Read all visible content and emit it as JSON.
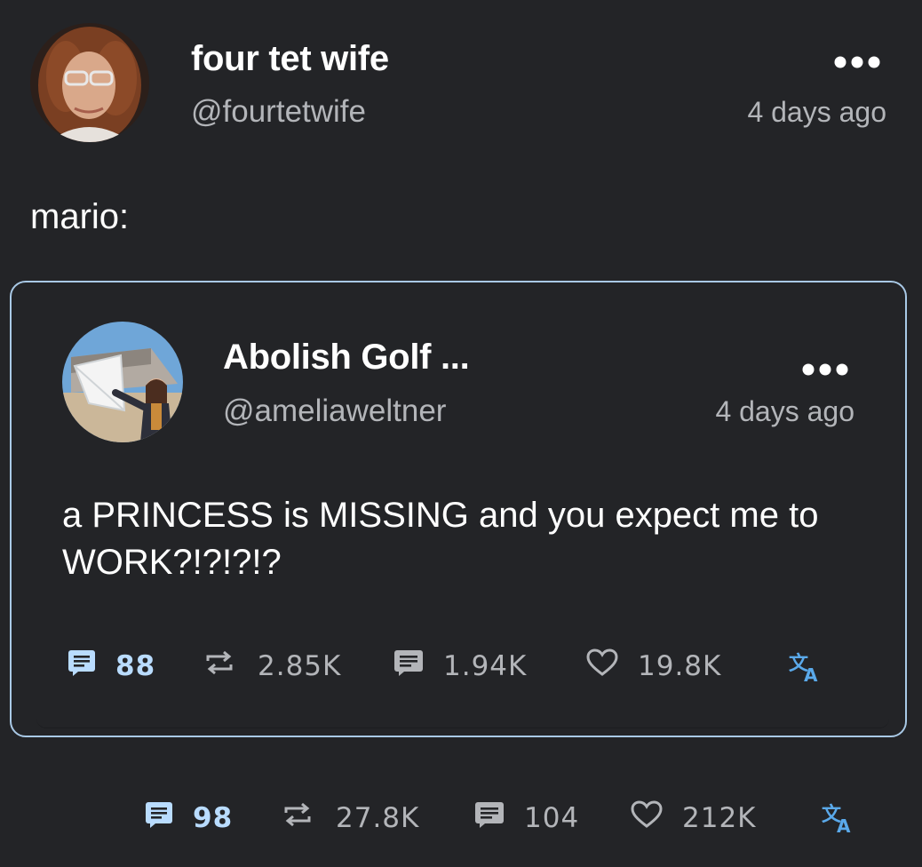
{
  "post": {
    "author": {
      "display_name": "four tet wife",
      "handle": "@fourtetwife"
    },
    "time": "4 days ago",
    "more_icon": "more-horizontal-icon",
    "text": "mario:",
    "quote": {
      "author": {
        "display_name": "Abolish Golf ...",
        "handle": "@ameliaweltner"
      },
      "time": "4 days ago",
      "text": "a PRINCESS is MISSING and you expect me to WORK?!?!?!?",
      "stats": {
        "quotes": "88",
        "reposts": "2.85K",
        "replies": "1.94K",
        "likes": "19.8K"
      }
    },
    "stats": {
      "quotes": "98",
      "reposts": "27.8K",
      "replies": "104",
      "likes": "212K"
    }
  },
  "colors": {
    "background": "#232427",
    "quote_border": "#a9c9e6",
    "quote_count": "#b9dcff",
    "muted_text": "#b3b5b9",
    "translate_accent": "#5aa9ea"
  },
  "icons": [
    "avatar",
    "more-horizontal-icon",
    "quote-icon",
    "repost-icon",
    "reply-icon",
    "heart-icon",
    "translate-icon"
  ]
}
